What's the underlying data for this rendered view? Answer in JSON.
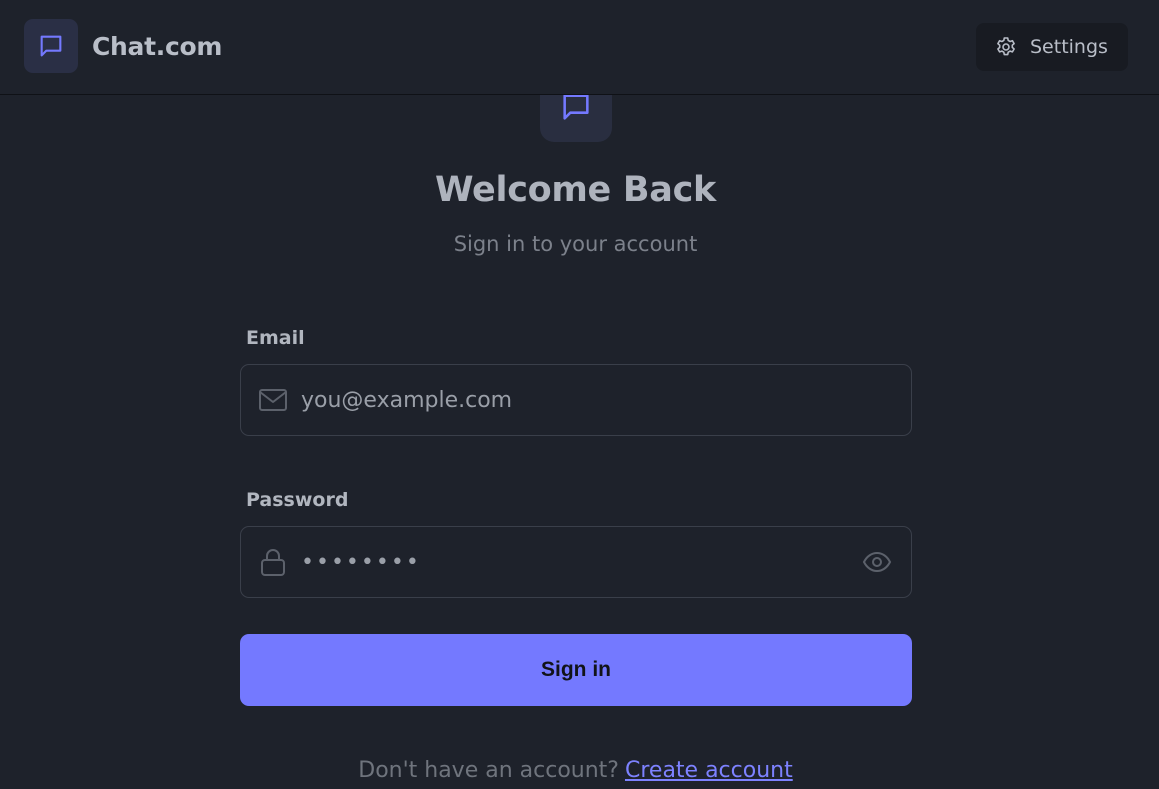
{
  "header": {
    "brand_name": "Chat.com",
    "settings_label": "Settings"
  },
  "login": {
    "title": "Welcome Back",
    "subtitle": "Sign in to your account",
    "email_label": "Email",
    "email_placeholder": "you@example.com",
    "password_label": "Password",
    "password_value": "••••••••",
    "submit_label": "Sign in",
    "footer_prompt": "Don't have an account?",
    "footer_link": "Create account"
  },
  "icons": {
    "brand": "chat-bubble-icon",
    "settings": "gear-icon",
    "email": "mail-icon",
    "password": "lock-icon",
    "toggle": "eye-icon"
  },
  "colors": {
    "background": "#1e222b",
    "accent": "#7479ff",
    "link": "#7d82ff"
  }
}
